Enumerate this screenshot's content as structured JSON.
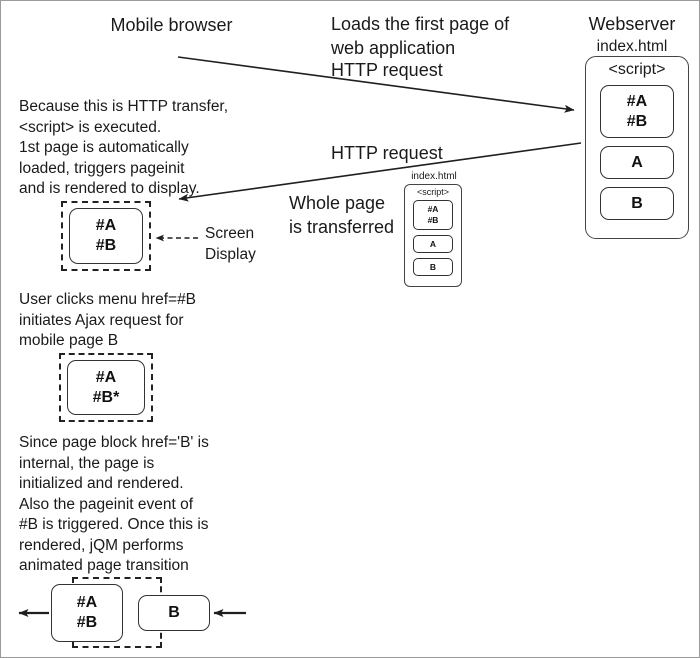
{
  "diagram": {
    "title_left": "Mobile browser",
    "title_right": "Webserver",
    "right_subtitle": "index.html",
    "labels": {
      "loads_first_page": "Loads the first page of\nweb application",
      "http_request_1": "HTTP request",
      "http_request_2": "HTTP request",
      "whole_page_transferred": "Whole page\nis transferred",
      "screen_display": "Screen\nDisplay"
    },
    "paragraphs": {
      "p1": "Because this is HTTP transfer,\n<script> is executed.\n1st page is automatically\nloaded, triggers pageinit\nand is rendered to display.",
      "p2": "User clicks menu href=#B\ninitiates Ajax request for\nmobile page B",
      "p3": "Since page block href='B' is\ninternal, the page is\ninitialized and rendered.\nAlso the pageinit event of\n#B is triggered. Once this is\nrendered, jQM performs\nanimated page transition"
    },
    "webserver": {
      "script_label": "<script>",
      "blocks": [
        {
          "line1": "#A",
          "line2": "#B"
        },
        {
          "line1": "A",
          "line2": ""
        },
        {
          "line1": "B",
          "line2": ""
        }
      ]
    },
    "transferred_page": {
      "caption": "index.html",
      "script_label": "<script>",
      "blocks": [
        {
          "line1": "#A",
          "line2": "#B"
        },
        {
          "line1": "A",
          "line2": ""
        },
        {
          "line1": "B",
          "line2": ""
        }
      ]
    },
    "screens": {
      "screen1": {
        "line1": "#A",
        "line2": "#B"
      },
      "screen2": {
        "line1": "#A",
        "line2": "#B*"
      },
      "screen3_out": {
        "line1": "#A",
        "line2": "#B"
      },
      "screen3_in": {
        "line1": "B",
        "line2": ""
      }
    },
    "colors": {
      "stroke": "#222222",
      "border": "#9a9a9a",
      "text": "#1a1a1a",
      "background": "#ffffff"
    },
    "icons": {
      "arrow_request": "arrow-right-icon",
      "arrow_response": "arrow-left-icon",
      "arrow_screen": "dashed-arrow-left-icon",
      "arrow_transition_out": "arrow-left-icon",
      "arrow_transition_in": "arrow-left-icon"
    }
  }
}
